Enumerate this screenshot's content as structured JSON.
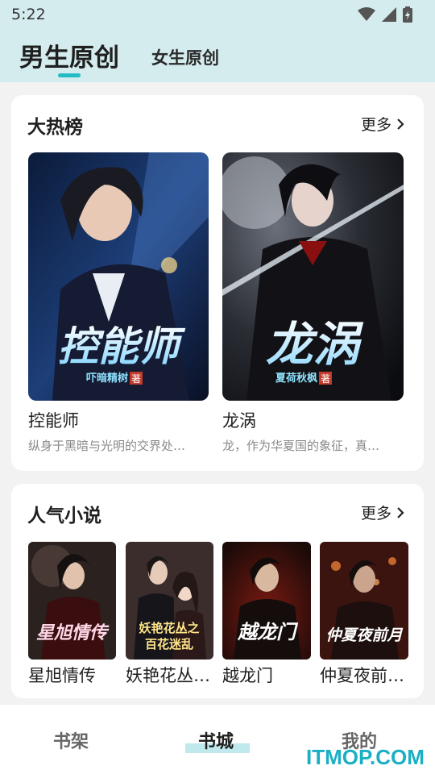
{
  "status": {
    "time": "5:22"
  },
  "tabs": {
    "male": "男生原创",
    "female": "女生原创"
  },
  "hot": {
    "title": "大热榜",
    "more": "更多",
    "books": [
      {
        "title": "控能师",
        "desc": "纵身于黑暗与光明的交界处…",
        "cover_text": "控能师",
        "author_tag": "吓暗精树",
        "author_mark": "著"
      },
      {
        "title": "龙涡",
        "desc": "龙，作为华夏国的象征，真…",
        "cover_text": "龙涡",
        "author_tag": "夏荷秋枫",
        "author_mark": "著"
      }
    ]
  },
  "popular": {
    "title": "人气小说",
    "more": "更多",
    "books": [
      {
        "title": "星旭情传",
        "cover_text": "星旭情传"
      },
      {
        "title": "妖艳花丛…",
        "cover_text_1": "妖艳花丛之",
        "cover_text_2": "百花迷乱"
      },
      {
        "title": "越龙门",
        "cover_text": "越龙门"
      },
      {
        "title": "仲夏夜前…",
        "cover_text": "仲夏夜前月"
      }
    ]
  },
  "nav": {
    "shelf": "书架",
    "store": "书城",
    "mine": "我的"
  },
  "watermark": "ITMOP.COM",
  "colors": {
    "header_bg": "#d5ecee",
    "accent": "#22bcc4"
  }
}
